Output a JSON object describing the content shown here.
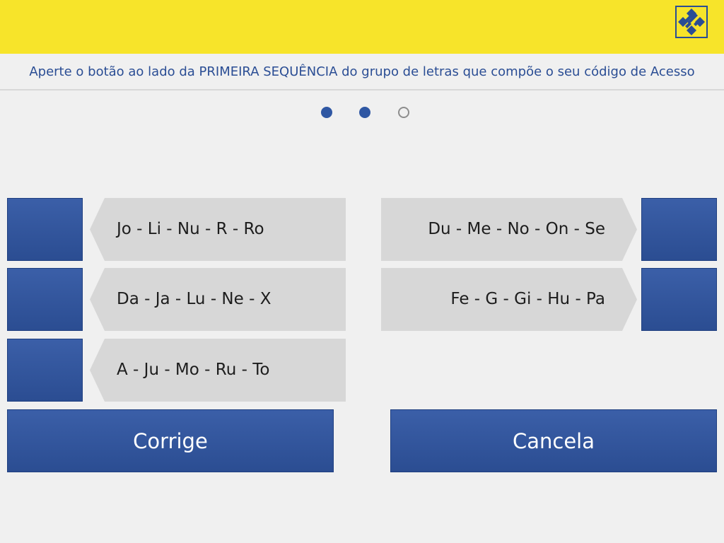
{
  "header": {
    "brand_color": "#f7e42a",
    "logo_icon": "banco-do-brasil-logo"
  },
  "instruction": "Aperte o botão ao lado da PRIMEIRA SEQUÊNCIA do grupo de letras que compõe o seu código de Acesso",
  "progress": {
    "steps_total": 3,
    "steps_filled": 2
  },
  "options_left": [
    {
      "label": "Jo - Li - Nu - R - Ro"
    },
    {
      "label": "Da - Ja - Lu - Ne - X"
    },
    {
      "label": "A - Ju - Mo - Ru - To"
    }
  ],
  "options_right": [
    {
      "label": "Du - Me - No - On - Se"
    },
    {
      "label": "Fe - G - Gi - Hu - Pa"
    }
  ],
  "actions": {
    "corrige": "Corrige",
    "cancela": "Cancela"
  },
  "colors": {
    "accent_blue": "#2f57a3",
    "option_gray": "#d7d7d7",
    "background": "#f0f0f0"
  }
}
